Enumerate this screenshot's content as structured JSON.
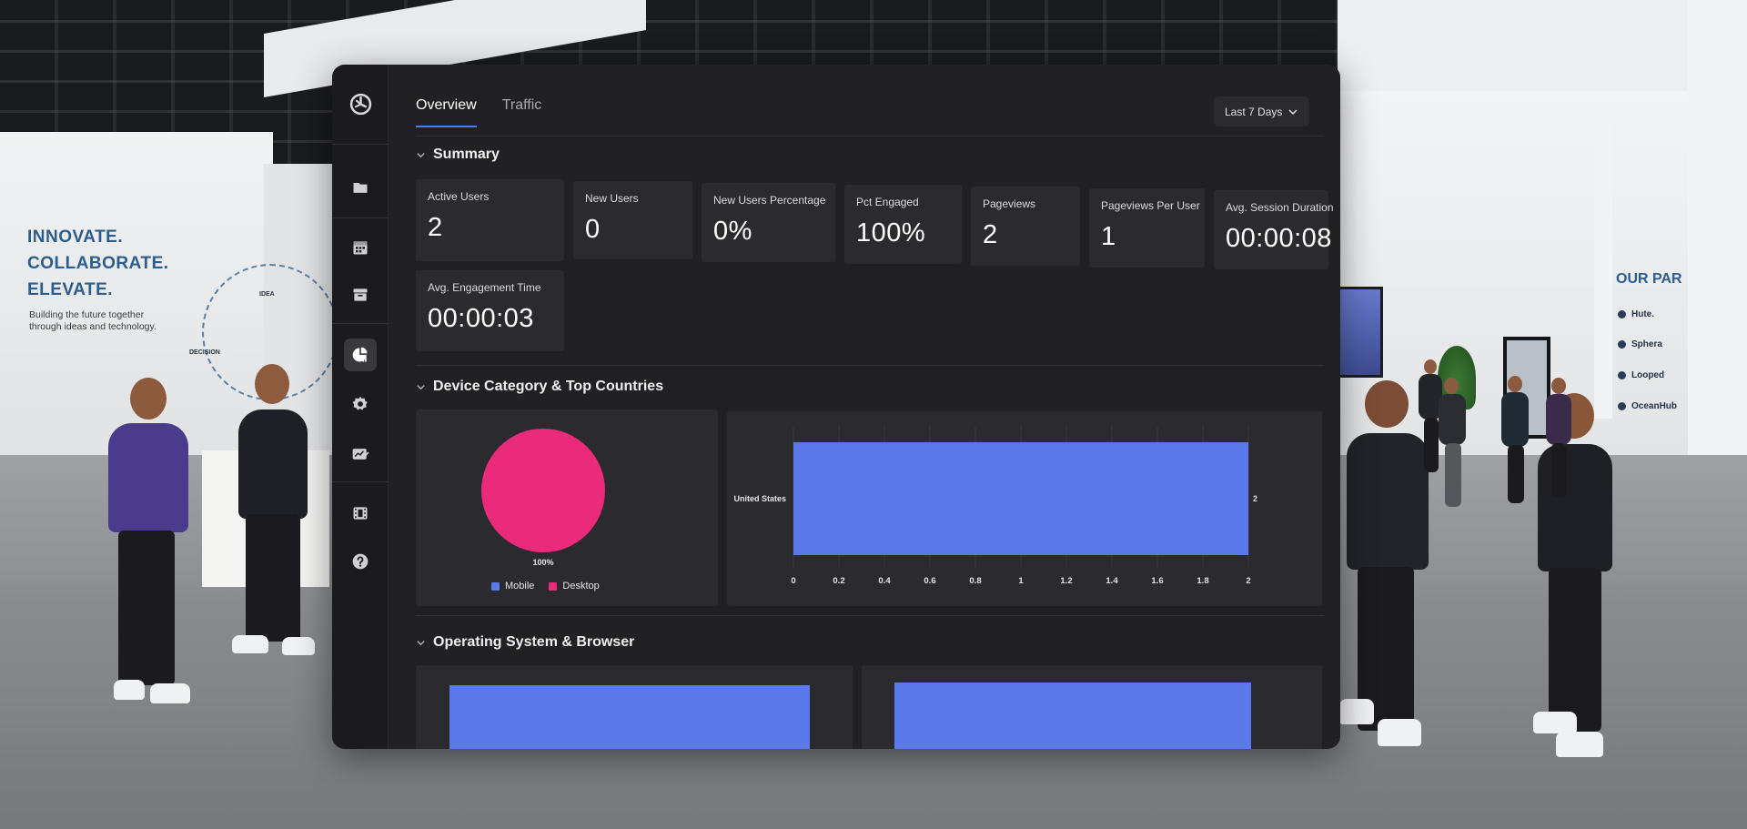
{
  "environment": {
    "wall_headline": [
      "INNOVATE.",
      "COLLABORATE.",
      "ELEVATE."
    ],
    "wall_subtext": "Building the future together through ideas and technology.",
    "diagram_labels": [
      "IDEA",
      "DECISION"
    ],
    "partners_title": "OUR PAR",
    "partners": [
      "Hute.",
      "Sphera",
      "Looped",
      "OceanHub"
    ]
  },
  "tabs": [
    {
      "label": "Overview",
      "active": true
    },
    {
      "label": "Traffic",
      "active": false
    }
  ],
  "date_range": {
    "label": "Last 7 Days",
    "icon": "chevron-down-icon"
  },
  "rail": {
    "logo_icon": "app-logo-icon",
    "items": [
      {
        "icon": "folder-icon",
        "active": false
      },
      {
        "icon": "calendar-icon",
        "active": false
      },
      {
        "icon": "archive-icon",
        "active": false
      },
      {
        "icon": "analytics-pie-icon",
        "active": true
      },
      {
        "icon": "gear-icon",
        "active": false
      },
      {
        "icon": "chart-edit-icon",
        "active": false
      },
      {
        "icon": "film-icon",
        "active": false
      },
      {
        "icon": "help-icon",
        "active": false
      }
    ]
  },
  "sections": {
    "summary": "Summary",
    "device": "Device Category & Top Countries",
    "os": "Operating System & Browser"
  },
  "stats": [
    {
      "label": "Active Users",
      "value": "2"
    },
    {
      "label": "New Users",
      "value": "0"
    },
    {
      "label": "New Users Percentage",
      "value": "0%"
    },
    {
      "label": "Pct Engaged",
      "value": "100%"
    },
    {
      "label": "Pageviews",
      "value": "2"
    },
    {
      "label": "Pageviews Per User",
      "value": "1"
    },
    {
      "label": "Avg. Session Duration",
      "value": "00:00:08"
    },
    {
      "label": "Avg. Engagement Time",
      "value": "00:00:03"
    }
  ],
  "colors": {
    "mobile": "#5b79ea",
    "desktop": "#ea2a7b",
    "bar": "#5b79ea",
    "accent": "#4f7bf0"
  },
  "chart_data": [
    {
      "type": "pie",
      "categories": [
        "Mobile",
        "Desktop"
      ],
      "values": [
        0,
        100
      ],
      "data_labels": [
        "100%"
      ],
      "legend": "bottom"
    },
    {
      "type": "bar",
      "orientation": "horizontal",
      "categories": [
        "United States"
      ],
      "values": [
        2
      ],
      "data_labels": [
        "2"
      ],
      "xlim": [
        0,
        2
      ],
      "xticks": [
        "0",
        "0.2",
        "0.4",
        "0.6",
        "0.8",
        "1",
        "1.2",
        "1.4",
        "1.6",
        "1.8",
        "2"
      ],
      "grid": true
    },
    {
      "type": "bar",
      "categories": [],
      "values": [
        1
      ],
      "note_visible": "single bar partially visible"
    },
    {
      "type": "bar",
      "categories": [],
      "values": [
        1
      ]
    }
  ]
}
